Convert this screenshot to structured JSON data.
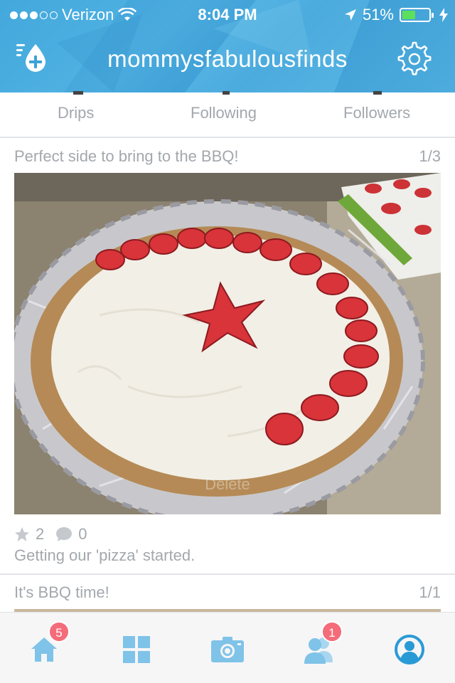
{
  "status_bar": {
    "carrier": "Verizon",
    "time": "8:04 PM",
    "battery_percent": "51%",
    "battery_level": 0.51,
    "signal_bars_filled": 3,
    "signal_bars_total": 5
  },
  "nav": {
    "title": "mommysfabulousfinds",
    "left_icon": "add-drip-icon",
    "right_icon": "gear-icon"
  },
  "profile_tabs": [
    "Drips",
    "Following",
    "Followers"
  ],
  "posts": [
    {
      "title": "Perfect side to bring to the BBQ!",
      "counter": "1/3",
      "photo_overlay": "Delete",
      "stars": "2",
      "comments": "0",
      "caption": "Getting our 'pizza' started."
    },
    {
      "title": "It's BBQ time!",
      "counter": "1/1"
    }
  ],
  "tab_bar": {
    "items": [
      {
        "name": "home-icon",
        "badge": "5"
      },
      {
        "name": "grid-icon",
        "badge": ""
      },
      {
        "name": "camera-icon",
        "badge": ""
      },
      {
        "name": "people-icon",
        "badge": "1"
      },
      {
        "name": "profile-icon",
        "badge": ""
      }
    ]
  },
  "colors": {
    "header_blue": "#3da2d8",
    "tab_icon_blue": "#7fc3e8",
    "active_tab_blue": "#2a9ad6",
    "badge_red": "#f46c7a"
  }
}
